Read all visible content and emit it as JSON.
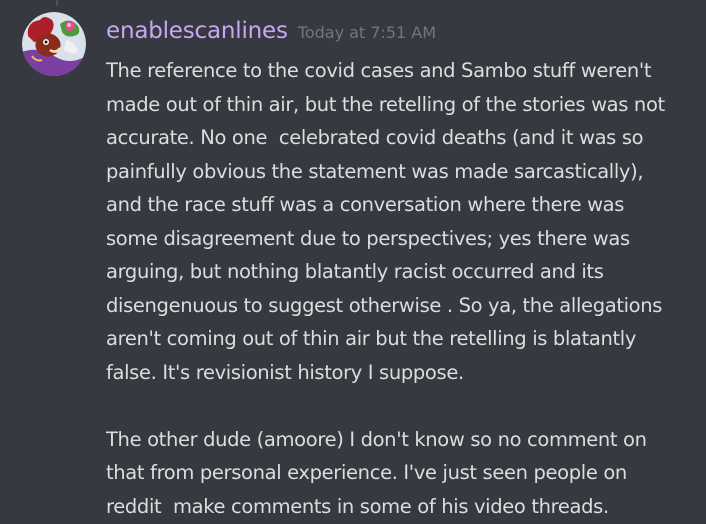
{
  "message": {
    "author": "enablescanlines",
    "timestamp": "Today at 7:51 AM",
    "lines": [
      "The reference to the covid cases and Sambo stuff weren't",
      "made out of thin air, but the retelling of the stories was not",
      "accurate. No one  celebrated covid deaths (and it was so",
      "painfully obvious the statement was made sarcastically),",
      "and the race stuff was a conversation where there was",
      "some disagreement due to perspectives; yes there was",
      "arguing, but nothing blatantly racist occurred and its",
      "disengenuous to suggest otherwise . So ya, the allegations",
      "aren't coming out of thin air but the retelling is blatantly",
      "false. It's revisionist history I suppose.",
      "",
      "The other dude (amoore) I don't know so no comment on",
      "that from personal experience. I've just seen people on",
      "reddit  make comments in some of his video threads."
    ]
  },
  "colors": {
    "background": "#36393f",
    "username": "#c8a6f2",
    "timestamp": "#72767d",
    "text": "#dcddde"
  }
}
